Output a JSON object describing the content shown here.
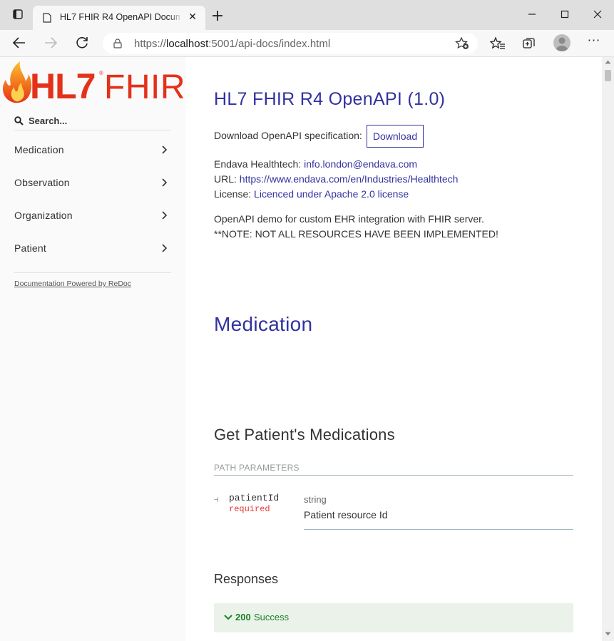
{
  "browser": {
    "tab_title": "HL7 FHIR R4 OpenAPI Documentation",
    "address_url_scheme": "https://",
    "address_url_host": "localhost",
    "address_url_path": ":5001/api-docs/index.html"
  },
  "sidebar": {
    "logo_text": "HL7 FHIR",
    "search_placeholder": "Search...",
    "items": [
      {
        "label": "Medication"
      },
      {
        "label": "Observation"
      },
      {
        "label": "Organization"
      },
      {
        "label": "Patient"
      }
    ],
    "powered_by": "Documentation Powered by ReDoc"
  },
  "content": {
    "title": "HL7 FHIR R4 OpenAPI (1.0)",
    "download_label": "Download OpenAPI specification:",
    "download_button": "Download",
    "contact_label": "Endava Healthtech:",
    "contact_email": "info.london@endava.com",
    "url_label": "URL:",
    "url_value": "https://www.endava.com/en/Industries/Healthtech",
    "license_label": "License:",
    "license_value": "Licenced under Apache 2.0 license",
    "description_line1": "OpenAPI demo for custom EHR integration with FHIR server.",
    "description_line2": "**NOTE: NOT ALL RESOURCES HAVE BEEN IMPLEMENTED!",
    "section_title": "Medication",
    "operation_title": "Get Patient's Medications",
    "path_params_title": "PATH PARAMETERS",
    "param": {
      "name": "patientId",
      "required": "required",
      "type": "string",
      "description": "Patient resource Id"
    },
    "responses_title": "Responses",
    "response": {
      "code": "200",
      "description": "Success"
    }
  },
  "colors": {
    "accent": "#32329f",
    "success": "#1d8127",
    "required": "#e53935"
  }
}
